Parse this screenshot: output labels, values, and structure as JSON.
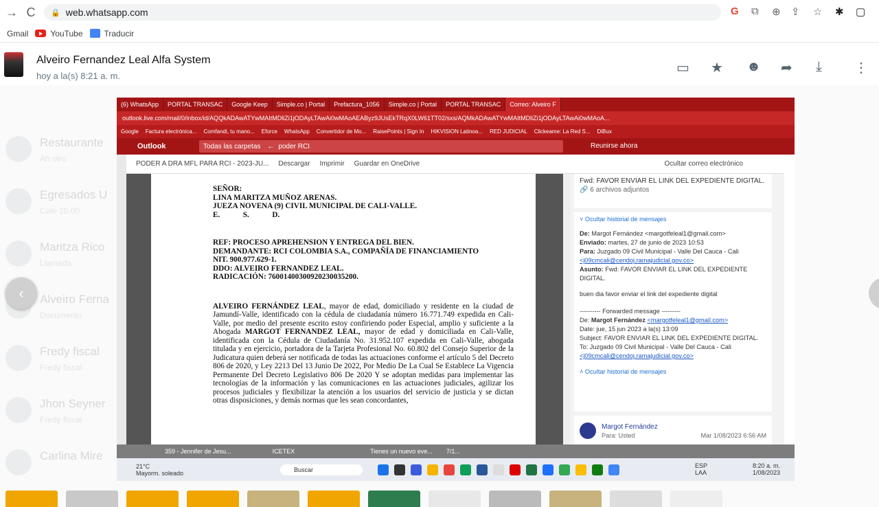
{
  "browser": {
    "url": "web.whatsapp.com",
    "bookmarks": [
      "Gmail",
      "YouTube",
      "Traducir"
    ]
  },
  "viewer": {
    "contact": "Alveiro Fernandez Leal Alfa System",
    "time": "hoy a la(s) 8:21 a. m."
  },
  "chats": [
    {
      "name": "Restaurante",
      "sub": "Ah otro"
    },
    {
      "name": "Egresados U",
      "sub": "Cole 20.00"
    },
    {
      "name": "Maritza Rico",
      "sub": "Llamada"
    },
    {
      "name": "Alveiro Ferna",
      "sub": "Documento"
    },
    {
      "name": "Fredy fiscal",
      "sub": "Fredy fiscal"
    },
    {
      "name": "Jhon Seyner",
      "sub": "Fredy fiscal"
    },
    {
      "name": "Carlina Mire",
      "sub": ""
    }
  ],
  "shot": {
    "tabs": [
      "(6) WhatsApp",
      "PORTAL TRANSAC",
      "Google Keep",
      "Simple.co | Portal",
      "Prefactura_1056",
      "Simple.co | Portal",
      "PORTAL TRANSAC",
      "Correo: Alveiro F"
    ],
    "url": "outlook.live.com/mail/0/inbox/id/AQQkADAwATYwMAItMDliZi1jODAyLTAwAi0wMAoAEAByz9JUsEkTRqX0LW61TT02/sxs/AQMkADAwATYwMAItMDliZi1jODAyLTAwAi0wMAoA...",
    "bookmarks": [
      "Google",
      "Factura electrónica...",
      "Comfandi, tu mano...",
      "Eforce",
      "WhatsApp",
      "Convertidor de Mo...",
      "RaisePoints | Sign In",
      "HIKVISION Latinoa...",
      "RED JUDICIAL",
      "Clickeame: La Red S...",
      "DiBux"
    ],
    "outlook": "Outlook",
    "folder": "Todas las carpetas",
    "search": "poder RCI",
    "meet": "Reunirse ahora",
    "doc_title": "PODER A DRA MFL PARA RCI - 2023-JU...",
    "download": "Descargar",
    "print": "Imprimir",
    "onedrive": "Guardar en OneDrive",
    "hide_mail": "Ocultar correo electrónico",
    "pdf": {
      "l1": "SEÑOR:",
      "l2": "LINA MARITZA MUÑOZ ARENAS.",
      "l3": "JUEZA NOVENA (9) CIVIL MUNICIPAL DE CALI-VALLE.",
      "l4": "E.            S.            D.",
      "r1": "REF: PROCESO APREHENSION Y ENTREGA DEL BIEN.",
      "r2": "DEMANDANTE: RCI COLOMBIA S.A., COMPAÑÍA DE FINANCIAMIENTO",
      "r3": "NIT. 900.977.629-1.",
      "r4": "DDO: ALVEIRO FERNANDEZ LEAL.",
      "r5": "RADICACIÓN: 76001400300920230035200.",
      "body_bold": "ALVEIRO FERNÁNDEZ LEAL",
      "body1": ", mayor de edad, domiciliado y residente en la ciudad de Jamundí-Valle, identificado con la cédula de ciudadanía número 16.771.749 expedida en Cali-Valle, por medio del presente escrito estoy confiriendo poder Especial, amplio y suficiente a la Abogada ",
      "body_bold2": "MARGOT FERNANDEZ LEAL,",
      "body2": " mayor de edad y domiciliada en Cali-Valle, identificada con la Cédula de Ciudadanía No. 31.952.107 expedida en Cali-Valle, abogada titulada y en ejercicio, portadora de la Tarjeta Profesional No. 60.802 del Consejo Superior de la Judicatura quien deberá ser notificada de todas las actuaciones conforme el artículo 5 del Decreto 806 de 2020, y  Ley 2213 Del 13 Junio De 2022, Por Medio De La Cual Se Establece La Vigencia Permanente Del Decreto Legislativo 806 De 2020 Y se adoptan medidas para implementar las tecnologías de la información y las comunicaciones en las actuaciones judiciales, agilizar los procesos judiciales y flexibilizar la atención a los usuarios del servicio de justicia y se dictan otras disposiciones, y demás normas que les sean concordantes,"
    },
    "mail": {
      "subject": "Fwd: FAVOR ENVIAR EL LINK DEL EXPEDIENTE DIGITAL.",
      "attach": "6 archivos adjuntos",
      "hide_hist": "Ocultar historial de mensajes",
      "de_label": "De:",
      "de": "Margot Fernández <margotfeleal1@gmail.com>",
      "env_label": "Enviado:",
      "env": "martes, 27 de junio de 2023 10:53",
      "para_label": "Para:",
      "para": "Juzgado 09 Civil Municipal - Valle Del Cauca - Cali",
      "para_mail": "<j09cmcali@cendoj.ramajudicial.gov.co>",
      "asunto_label": "Asunto:",
      "asunto": "Fwd: FAVOR ENVIAR EL LINK DEL EXPEDIENTE DIGITAL.",
      "body": "buen dia favor enviar el link del expediente digital",
      "fwd": "---------- Forwarded message ---------",
      "fwd_de": "De: ",
      "fwd_name": "Margot Fernández",
      "fwd_mail": "<margotfeleal1@gmail.com>",
      "fwd_date": "Date: jue, 15 jun 2023 a la(s) 13:09",
      "fwd_subj": "Subject: FAVOR ENVIAR EL LINK DEL EXPEDIENTE DIGITAL.",
      "fwd_to": "To: Juzgado 09 Civil Municipal - Valle Del Cauca - Cali",
      "fwd_to_mail": "<j09cmcali@cendoj.ramajudicial.gov.co>",
      "hide_hist2": "Ocultar historial de mensajes",
      "sender": "Margot Fernández",
      "to_label": "Para: Usted",
      "sent_time": "Mar 1/08/2023 6:56 AM"
    },
    "pre_taskbar": [
      "359 - Jennifer de Jesu...",
      "ICETEX",
      "Tienes un nuevo eve...",
      "7/1..."
    ],
    "weather_temp": "21°C",
    "weather_text": "Mayorm. soleado",
    "taskbar_search": "Buscar",
    "lang": "ESP",
    "lang2": "LAA",
    "clock_time": "8:20 a. m.",
    "clock_date": "1/08/2023"
  }
}
